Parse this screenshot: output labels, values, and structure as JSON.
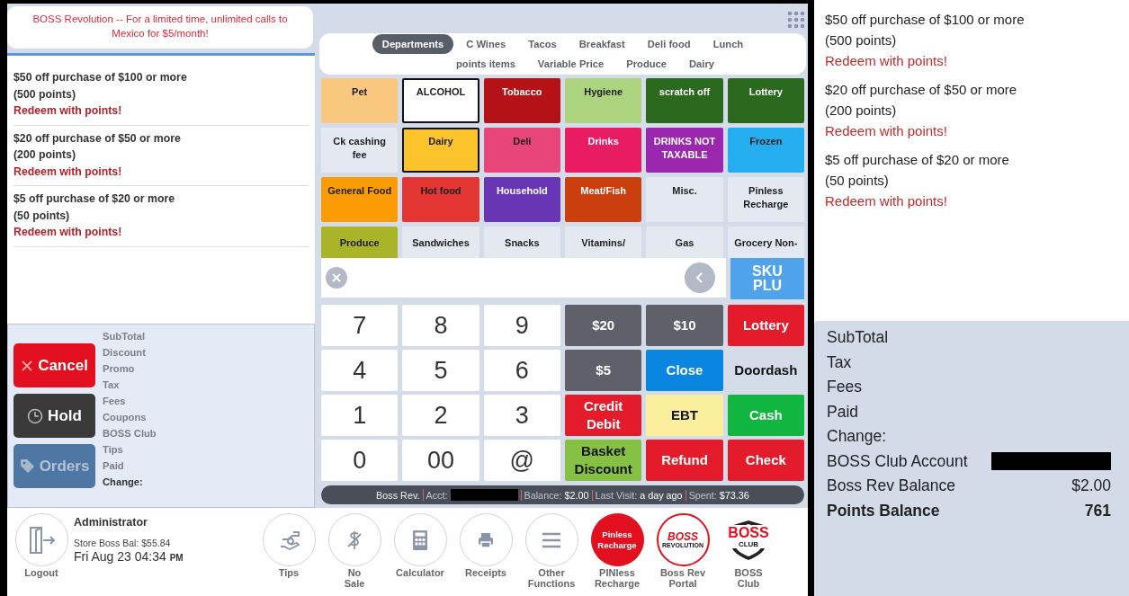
{
  "promo_banner": "BOSS Revolution -- For a limited time, unlimited calls to Mexico for $5/month!",
  "offers": [
    {
      "title": "$50 off purchase of $100 or more",
      "points": "(500 points)",
      "action": "Redeem with points!"
    },
    {
      "title": "$20 off purchase of $50 or more",
      "points": "(200 points)",
      "action": "Redeem with points!"
    },
    {
      "title": "$5 off purchase of $20 or more",
      "points": "(50 points)",
      "action": "Redeem with points!"
    }
  ],
  "action_buttons": [
    {
      "kind": "cancel",
      "label": "Cancel",
      "disabled": false
    },
    {
      "kind": "hold",
      "label": "Hold",
      "disabled": false
    },
    {
      "kind": "orders",
      "label": "Orders",
      "disabled": true
    }
  ],
  "summary_labels": [
    {
      "text": "SubTotal",
      "emphasis": false
    },
    {
      "text": "Discount",
      "emphasis": false
    },
    {
      "text": "Promo",
      "emphasis": false
    },
    {
      "text": "Tax",
      "emphasis": false
    },
    {
      "text": "Fees",
      "emphasis": false
    },
    {
      "text": "Coupons",
      "emphasis": false
    },
    {
      "text": "BOSS Club",
      "emphasis": false
    },
    {
      "text": "Tips",
      "emphasis": false
    },
    {
      "text": "Paid",
      "emphasis": false
    },
    {
      "text": "Change:",
      "emphasis": true
    }
  ],
  "category_tabs": [
    {
      "label": "Departments",
      "selected": true
    },
    {
      "label": "C Wines",
      "selected": false
    },
    {
      "label": "Tacos",
      "selected": false
    },
    {
      "label": "Breakfast",
      "selected": false
    },
    {
      "label": "Deli food",
      "selected": false
    },
    {
      "label": "Lunch",
      "selected": false
    },
    {
      "label": "points items",
      "selected": false
    },
    {
      "label": "Variable Price",
      "selected": false
    },
    {
      "label": "Produce",
      "selected": false
    },
    {
      "label": "Dairy",
      "selected": false
    }
  ],
  "departments": [
    {
      "label": "Pet",
      "color": "#f9c77e",
      "kind": "dark",
      "selected": false
    },
    {
      "label": "ALCOHOL",
      "color": "#ffffff",
      "kind": "dark",
      "selected": true
    },
    {
      "label": "Tobacco",
      "color": "#b41217",
      "kind": "light",
      "selected": false
    },
    {
      "label": "Hygiene",
      "color": "#acd47e",
      "kind": "dark",
      "selected": false
    },
    {
      "label": "scratch off",
      "color": "#2b6a1e",
      "kind": "light",
      "selected": false
    },
    {
      "label": "Lottery",
      "color": "#2b6a1e",
      "kind": "light",
      "selected": false
    },
    {
      "label": "Ck cashing fee",
      "color": "#e4e8f0",
      "kind": "dark",
      "selected": false
    },
    {
      "label": "Dairy",
      "color": "#fcc42a",
      "kind": "dark",
      "selected": true
    },
    {
      "label": "Deli",
      "color": "#e8457a",
      "kind": "dark",
      "selected": false
    },
    {
      "label": "Drinks",
      "color": "#e91b62",
      "kind": "light",
      "selected": false
    },
    {
      "label": "DRINKS NOT TAXABLE",
      "color": "#9b27ae",
      "kind": "light",
      "selected": false
    },
    {
      "label": "Frozen",
      "color": "#24aef0",
      "kind": "dark",
      "selected": false
    },
    {
      "label": "General Food",
      "color": "#fb9c05",
      "kind": "dark",
      "selected": false
    },
    {
      "label": "Hot food",
      "color": "#e33531",
      "kind": "dark",
      "selected": false
    },
    {
      "label": "Household",
      "color": "#6836b4",
      "kind": "light",
      "selected": false
    },
    {
      "label": "Meat/Fish",
      "color": "#cb3f0e",
      "kind": "light",
      "selected": false
    },
    {
      "label": "Misc.",
      "color": "#e4e8f0",
      "kind": "dark",
      "selected": false
    },
    {
      "label": "Pinless Recharge",
      "color": "#e4e8f0",
      "kind": "dark",
      "selected": false
    },
    {
      "label": "Produce",
      "color": "#a9b426",
      "kind": "dark",
      "selected": false
    },
    {
      "label": "Sandwiches",
      "color": "#e4e8f0",
      "kind": "dark",
      "selected": false
    },
    {
      "label": "Snacks",
      "color": "#e4e8f0",
      "kind": "dark",
      "selected": false
    },
    {
      "label": "Vitamins/",
      "color": "#e4e8f0",
      "kind": "dark",
      "selected": false
    },
    {
      "label": "Gas",
      "color": "#e4e8f0",
      "kind": "dark",
      "selected": false
    },
    {
      "label": "Grocery Non-",
      "color": "#e4e8f0",
      "kind": "dark",
      "selected": false
    }
  ],
  "sku_button": "SKU\nPLU",
  "keypad": [
    {
      "label": "7",
      "kind": "digit"
    },
    {
      "label": "8",
      "kind": "digit"
    },
    {
      "label": "9",
      "kind": "digit"
    },
    {
      "label": "$20",
      "kind": "light",
      "color": "#5f6069"
    },
    {
      "label": "$10",
      "kind": "light",
      "color": "#5f6069"
    },
    {
      "label": "Lottery",
      "kind": "light",
      "color": "#e31b2b"
    },
    {
      "label": "4",
      "kind": "digit"
    },
    {
      "label": "5",
      "kind": "digit"
    },
    {
      "label": "6",
      "kind": "digit"
    },
    {
      "label": "$5",
      "kind": "light",
      "color": "#5f6069"
    },
    {
      "label": "Close",
      "kind": "light",
      "color": "#0b86e0"
    },
    {
      "label": "Doordash",
      "kind": "plain"
    },
    {
      "label": "1",
      "kind": "digit"
    },
    {
      "label": "2",
      "kind": "digit"
    },
    {
      "label": "3",
      "kind": "digit"
    },
    {
      "label": "Credit\nDebit",
      "kind": "light",
      "color": "#e31b2b"
    },
    {
      "label": "EBT",
      "kind": "dark",
      "color": "#fbef9e"
    },
    {
      "label": "Cash",
      "kind": "light",
      "color": "#10b63f"
    },
    {
      "label": "0",
      "kind": "digit"
    },
    {
      "label": "00",
      "kind": "digit"
    },
    {
      "label": "@",
      "kind": "digit"
    },
    {
      "label": "Basket\nDiscount",
      "kind": "dark",
      "color": "#86c143"
    },
    {
      "label": "Refund",
      "kind": "light",
      "color": "#e31b2b"
    },
    {
      "label": "Check",
      "kind": "light",
      "color": "#e31b2b"
    }
  ],
  "status_bar": [
    {
      "label": "Boss Rev.",
      "redacted": false
    },
    {
      "label": "Acct:",
      "redacted": true
    },
    {
      "label": "Balance:",
      "value": "$2.00",
      "redacted": false
    },
    {
      "label": "Last Visit:",
      "value": "a day ago",
      "redacted": false
    },
    {
      "label": "Spent:",
      "value": "$73.36",
      "redacted": false
    }
  ],
  "user": {
    "logout": "Logout",
    "name": "Administrator",
    "store_balance": "Store Boss Bal: $55.84",
    "date": "Fri Aug 23 04:34",
    "meridiem": "PM"
  },
  "toolbar": [
    {
      "kind": "tips",
      "label": "Tips"
    },
    {
      "kind": "no-sale",
      "label": "No\nSale"
    },
    {
      "kind": "calculator",
      "label": "Calculator"
    },
    {
      "kind": "receipts",
      "label": "Receipts"
    },
    {
      "kind": "other",
      "label": "Other\nFunctions"
    },
    {
      "kind": "pinless",
      "label": "PINless\nRecharge",
      "logo": "Pinless\nRecharge"
    },
    {
      "kind": "bossrev",
      "label": "Boss Rev\nPortal",
      "logo": "BOSS",
      "logo_sub": "REVOLUTION"
    },
    {
      "kind": "bossclub",
      "label": "BOSS\nClub",
      "logo": "BOSS",
      "logo_sub": "CLUB"
    }
  ],
  "customer_display": {
    "offers": [
      {
        "title": "$50 off purchase of $100 or more",
        "points": "(500 points)",
        "action": "Redeem with points!"
      },
      {
        "title": "$20 off purchase of $50 or more",
        "points": "(200 points)",
        "action": "Redeem with points!"
      },
      {
        "title": "$5 off purchase of $20 or more",
        "points": "(50 points)",
        "action": "Redeem with points!"
      }
    ],
    "totals": [
      {
        "label": "SubTotal",
        "kind": "plain",
        "emphasis": false
      },
      {
        "label": "Tax",
        "kind": "plain",
        "emphasis": false
      },
      {
        "label": "Fees",
        "kind": "plain",
        "emphasis": false
      },
      {
        "label": "Paid",
        "kind": "plain",
        "emphasis": false
      },
      {
        "label": "Change:",
        "kind": "plain",
        "emphasis": false
      },
      {
        "label": "BOSS Club Account",
        "kind": "redacted",
        "emphasis": false
      },
      {
        "label": "Boss Rev Balance",
        "kind": "value",
        "value": "$2.00",
        "emphasis": false
      },
      {
        "label": "Points Balance",
        "kind": "value",
        "value": "761",
        "emphasis": true
      }
    ]
  }
}
